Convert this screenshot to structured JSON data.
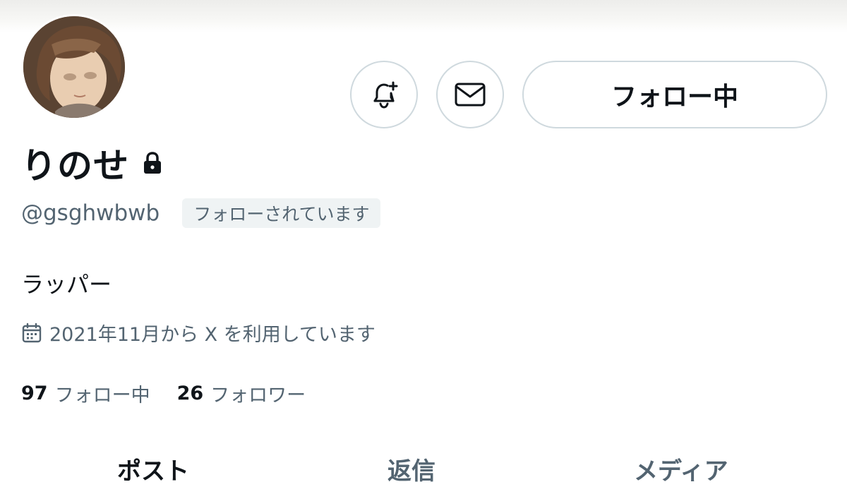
{
  "profile": {
    "display_name": "りのせ",
    "handle": "@gsghwbwb",
    "follows_you_badge": "フォローされています",
    "bio": "ラッパー",
    "joined": "2021年11月から X を利用しています"
  },
  "actions": {
    "follow_button_label": "フォロー中"
  },
  "stats": {
    "following_count": "97",
    "following_label": "フォロー中",
    "followers_count": "26",
    "followers_label": "フォロワー"
  },
  "tabs": [
    {
      "label": "ポスト"
    },
    {
      "label": "返信"
    },
    {
      "label": "メディア"
    }
  ],
  "icons": {
    "notify": "bell-plus-icon",
    "message": "envelope-icon",
    "protected": "lock-icon",
    "joined": "calendar-icon"
  },
  "colors": {
    "text_primary": "#0f1419",
    "text_secondary": "#536471",
    "border": "#cfd9de",
    "badge_bg": "#eff3f4"
  }
}
